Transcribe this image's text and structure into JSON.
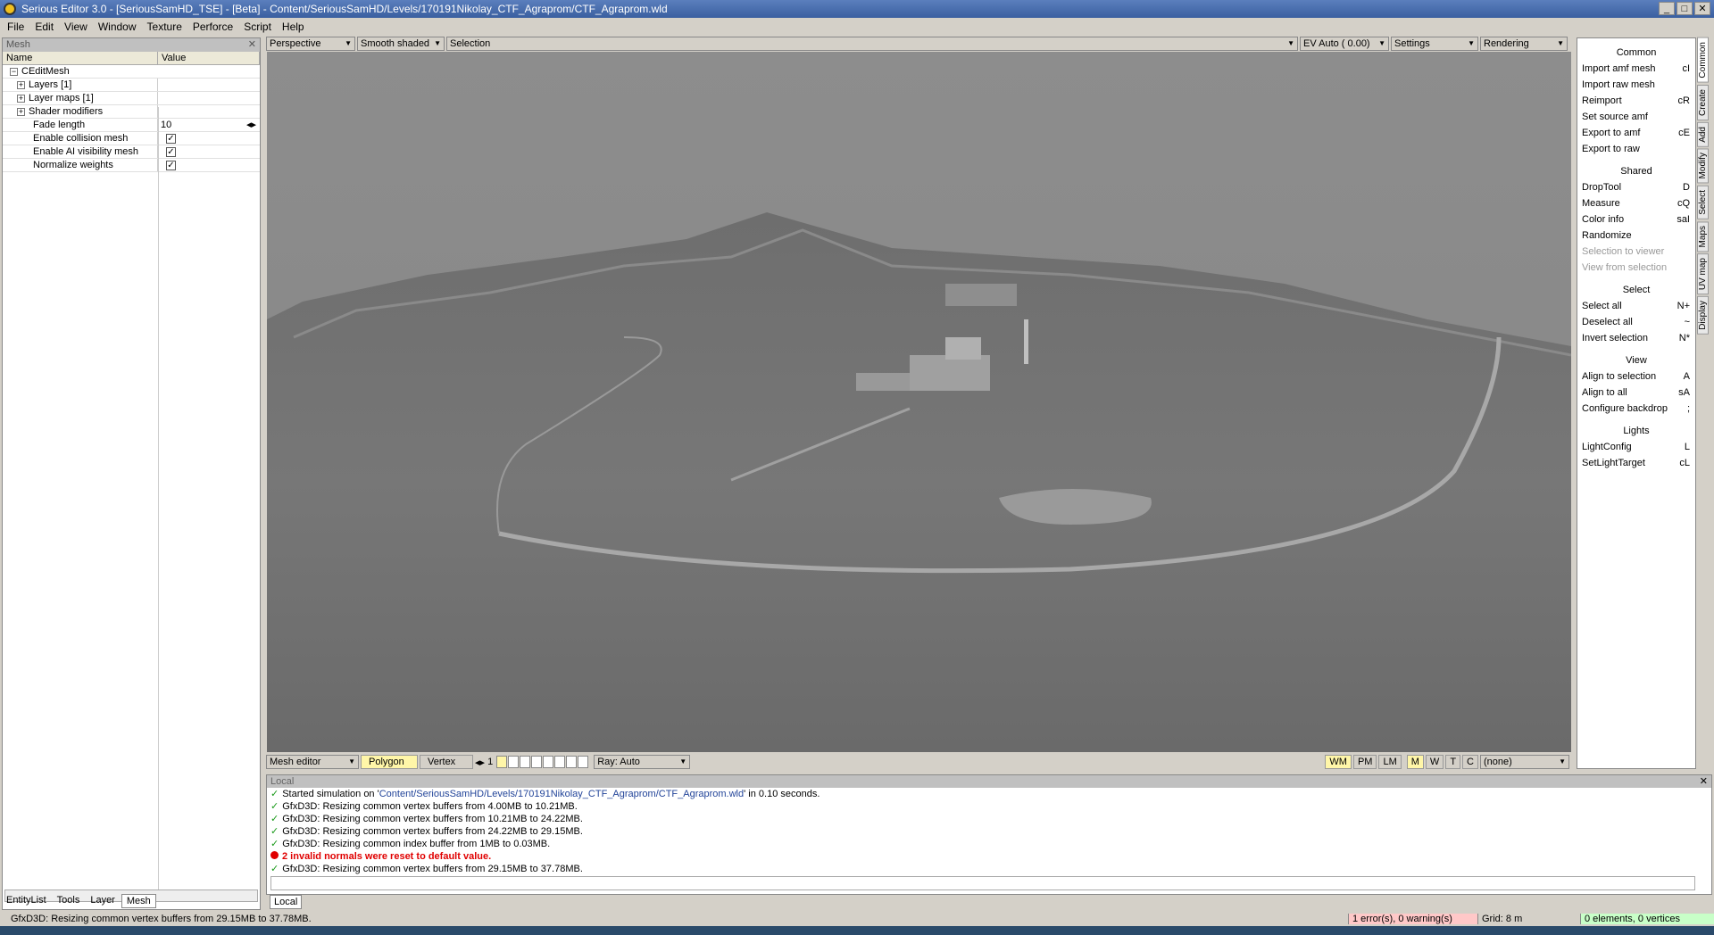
{
  "window": {
    "title": "Serious Editor 3.0 - [SeriousSamHD_TSE] - [Beta] - Content/SeriousSamHD/Levels/170191Nikolay_CTF_Agraprom/CTF_Agraprom.wld",
    "min": "_",
    "max": "□",
    "close": "✕"
  },
  "menu": [
    "File",
    "Edit",
    "View",
    "Window",
    "Texture",
    "Perforce",
    "Script",
    "Help"
  ],
  "left_panel": {
    "caption": "Mesh",
    "close": "✕",
    "col_name": "Name",
    "col_value": "Value",
    "root": "CEditMesh",
    "rows": [
      {
        "name": "Layers [1]",
        "expand": "+"
      },
      {
        "name": "Layer maps [1]",
        "expand": "+"
      },
      {
        "name": "Shader modifiers",
        "expand": "+"
      }
    ],
    "fade_label": "Fade length",
    "fade_value": "10",
    "checks": [
      {
        "name": "Enable collision mesh",
        "mark": "✓"
      },
      {
        "name": "Enable AI visibility mesh",
        "mark": "✓"
      },
      {
        "name": "Normalize weights",
        "mark": "✓"
      }
    ],
    "tabs": [
      "EntityList",
      "Tools",
      "Layer",
      "Mesh"
    ]
  },
  "viewport_bar": {
    "projection": "Perspective",
    "shading": "Smooth shaded",
    "selection": "Selection",
    "ev": "EV Auto ( 0.00)",
    "settings": "Settings",
    "rendering": "Rendering"
  },
  "mode_bar": {
    "editor": "Mesh editor",
    "polygon": "Polygon",
    "vertex": "Vertex",
    "page": "1",
    "ray": "Ray: Auto",
    "toggles": [
      "WM",
      "PM",
      "LM",
      "M",
      "W",
      "T",
      "C"
    ],
    "none": "(none)"
  },
  "right_panel": {
    "sections": [
      {
        "title": "Common",
        "items": [
          {
            "label": "Import amf mesh",
            "key": "cI"
          },
          {
            "label": "Import raw mesh",
            "key": ""
          },
          {
            "label": "Reimport",
            "key": "cR"
          },
          {
            "label": "Set source amf",
            "key": ""
          },
          {
            "label": "Export to amf",
            "key": "cE"
          },
          {
            "label": "Export to raw",
            "key": ""
          }
        ]
      },
      {
        "title": "Shared",
        "items": [
          {
            "label": "DropTool",
            "key": "D"
          },
          {
            "label": "Measure",
            "key": "cQ"
          },
          {
            "label": "Color info",
            "key": "saI"
          },
          {
            "label": "Randomize",
            "key": ""
          },
          {
            "label": "Selection to viewer",
            "key": "",
            "disabled": true
          },
          {
            "label": "View from selection",
            "key": "",
            "disabled": true
          }
        ]
      },
      {
        "title": "Select",
        "items": [
          {
            "label": "Select all",
            "key": "N+"
          },
          {
            "label": "Deselect all",
            "key": "~"
          },
          {
            "label": "Invert selection",
            "key": "N*"
          }
        ]
      },
      {
        "title": "View",
        "items": [
          {
            "label": "Align to selection",
            "key": "A"
          },
          {
            "label": "Align to all",
            "key": "sA"
          },
          {
            "label": "Configure backdrop",
            "key": ";"
          }
        ]
      },
      {
        "title": "Lights",
        "items": [
          {
            "label": "LightConfig",
            "key": "L"
          },
          {
            "label": "SetLightTarget",
            "key": "cL"
          }
        ]
      }
    ],
    "vtabs": [
      "Common",
      "Create",
      "Add",
      "Modify",
      "Select",
      "Maps",
      "UV map",
      "Display"
    ]
  },
  "log": {
    "caption": "Local",
    "close": "✕",
    "line0_prefix": "Started simulation on '",
    "line0_path": "Content/SeriousSamHD/Levels/170191Nikolay_CTF_Agraprom/CTF_Agraprom.wld",
    "line0_suffix": "' in 0.10 seconds.",
    "lines": [
      {
        "text": "GfxD3D: Resizing common vertex buffers from 4.00MB to 10.21MB.",
        "error": false
      },
      {
        "text": "GfxD3D: Resizing common vertex buffers from 10.21MB to 24.22MB.",
        "error": false
      },
      {
        "text": "GfxD3D: Resizing common vertex buffers from 24.22MB to 29.15MB.",
        "error": false
      },
      {
        "text": "GfxD3D: Resizing common index buffer from 1MB to 0.03MB.",
        "error": false
      },
      {
        "text": "2 invalid normals were reset to default value.",
        "error": true
      },
      {
        "text": "GfxD3D: Resizing common vertex buffers from 29.15MB to 37.78MB.",
        "error": false
      }
    ],
    "check": "✓",
    "tab": "Local"
  },
  "status": {
    "message": "GfxD3D: Resizing common vertex buffers from 29.15MB to 37.78MB.",
    "errors": "1 error(s), 0 warning(s)",
    "grid": "Grid: 8 m",
    "elements": "0 elements, 0 vertices"
  }
}
